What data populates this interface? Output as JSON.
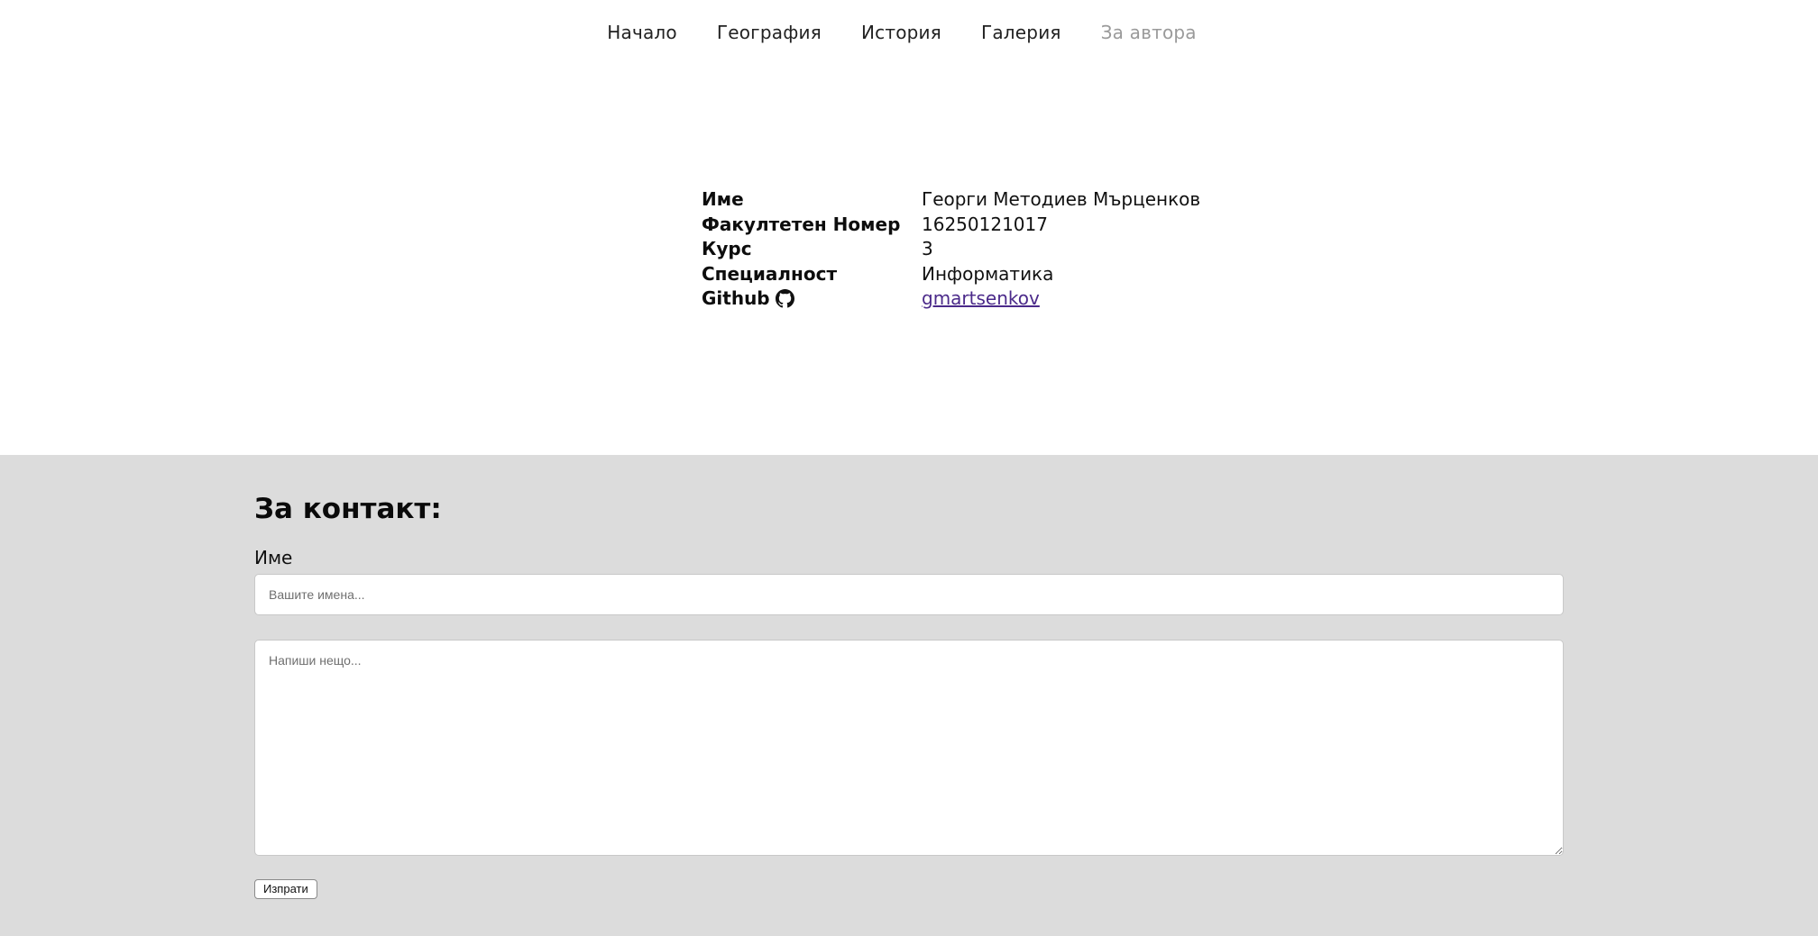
{
  "nav": {
    "items": [
      {
        "label": "Начало",
        "active": false
      },
      {
        "label": "География",
        "active": false
      },
      {
        "label": "История",
        "active": false
      },
      {
        "label": "Галерия",
        "active": false
      },
      {
        "label": "За автора",
        "active": true
      }
    ]
  },
  "author": {
    "rows": [
      {
        "label": "Име",
        "value": "Георги Методиев Мърценков"
      },
      {
        "label": "Факултетен Номер",
        "value": "16250121017"
      },
      {
        "label": "Курс",
        "value": "3"
      },
      {
        "label": "Специалност",
        "value": "Информатика"
      },
      {
        "label": "Github",
        "value": "gmartsenkov",
        "icon": "github-icon",
        "link": true
      }
    ]
  },
  "contact": {
    "title": "За контакт:",
    "name_label": "Име",
    "name_placeholder": "Вашите имена...",
    "name_value": "",
    "message_placeholder": "Напиши нещо...",
    "message_value": "",
    "submit_label": "Изпрати"
  },
  "colors": {
    "background": "#ffffff",
    "contact_background": "#dcdcdc",
    "nav_active": "#9a9a9a",
    "link": "#4b2a8a"
  }
}
